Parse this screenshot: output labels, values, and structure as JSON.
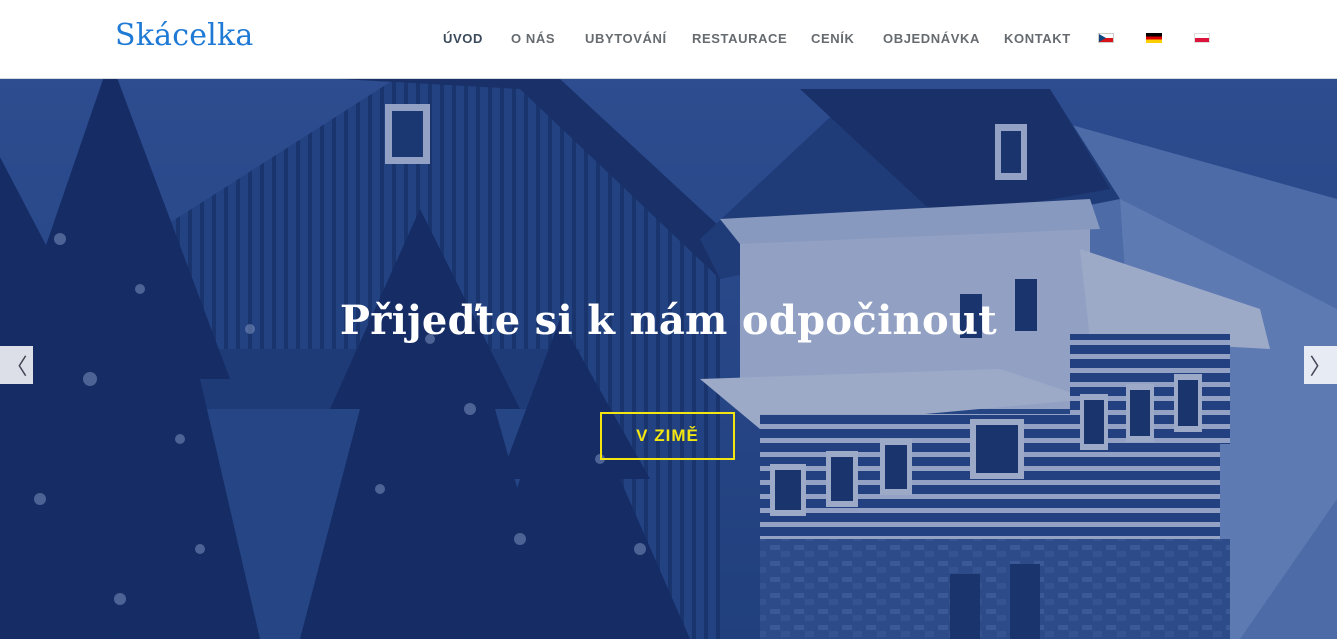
{
  "brand": {
    "logo_text": "Skácelka",
    "logo_color": "#1f7ad6"
  },
  "nav": {
    "items": [
      {
        "label": "ÚVOD",
        "active": true
      },
      {
        "label": "O NÁS"
      },
      {
        "label": "UBYTOVÁNÍ"
      },
      {
        "label": "RESTAURACE"
      },
      {
        "label": "CENÍK"
      },
      {
        "label": "OBJEDNÁVKA"
      },
      {
        "label": "KONTAKT"
      }
    ],
    "languages": [
      {
        "code": "cs",
        "icon": "czech-flag-icon"
      },
      {
        "code": "de",
        "icon": "german-flag-icon"
      },
      {
        "code": "pl",
        "icon": "polish-flag-icon"
      }
    ]
  },
  "hero": {
    "title": "Přijeďte si k nám odpočinout",
    "cta_label": "V ZIMĚ",
    "cta_color": "#f2e512",
    "prev_icon": "chevron-left-icon",
    "next_icon": "chevron-right-icon",
    "prev_glyph": "〈",
    "next_glyph": "〉"
  }
}
